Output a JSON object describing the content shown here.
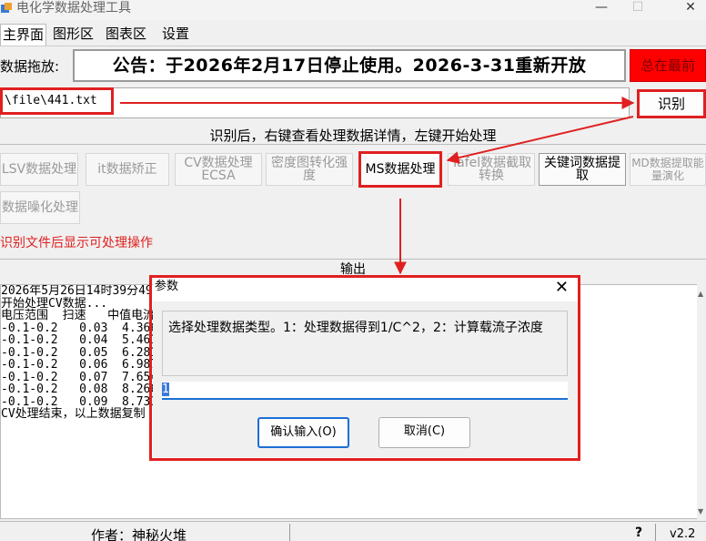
{
  "window": {
    "title": "电化学数据处理工具",
    "minimize": "—",
    "maximize": "☐",
    "close": "✕"
  },
  "menu": {
    "tabs": [
      "主界面",
      "图形区",
      "图表区",
      "设置"
    ]
  },
  "top": {
    "drag_label": "数据拖放:",
    "notice": "公告：于2026年2月17日停止使用。2026-3-31重新开放",
    "topmost_button": "总在最前",
    "path_value": "\\file\\441.txt",
    "recognize_button": "识别"
  },
  "hint": "识别后，右键查看处理数据详情，左键开始处理",
  "operations": [
    {
      "label": "LSV数据处理"
    },
    {
      "label": "it数据矫正"
    },
    {
      "label": "CV数据处理 ECSA"
    },
    {
      "label": "密度图转化强度"
    },
    {
      "label": "MS数据处理"
    },
    {
      "label": "Tafel数据截取转换"
    },
    {
      "label": "关键词数据提取"
    },
    {
      "label": "MD数据提取能量演化"
    },
    {
      "label": "数据噪化处理"
    }
  ],
  "red_hint": "识别文件后显示可处理操作",
  "output": {
    "header": "输出",
    "lines": [
      "2026年5月26日14时39分49",
      "开始处理CV数据...",
      "电压范围  扫速   中值电流",
      "-0.1-0.2   0.03  4.366e-",
      "-0.1-0.2   0.04  5.461e-",
      "-0.1-0.2   0.05  6.281e-",
      "-0.1-0.2   0.06  6.987e-",
      "-0.1-0.2   0.07  7.654e-",
      "-0.1-0.2   0.08  8.2665e",
      "-0.1-0.2   0.09  8.7335e",
      "CV处理结束，以上数据复制"
    ]
  },
  "status": {
    "author": "作者：神秘火堆",
    "help": "?",
    "version": "v2.2"
  },
  "dialog": {
    "title": "参数",
    "close": "✕",
    "prompt": "选择处理数据类型。1：处理数据得到1/C^2，2：计算载流子浓度",
    "input_value": "1",
    "ok_button": "确认输入(O)",
    "cancel_button": "取消(C)"
  },
  "colors": {
    "annotation_red": "#e02020",
    "focus_blue": "#1b6fd6",
    "topmost_red": "#ff0000"
  }
}
